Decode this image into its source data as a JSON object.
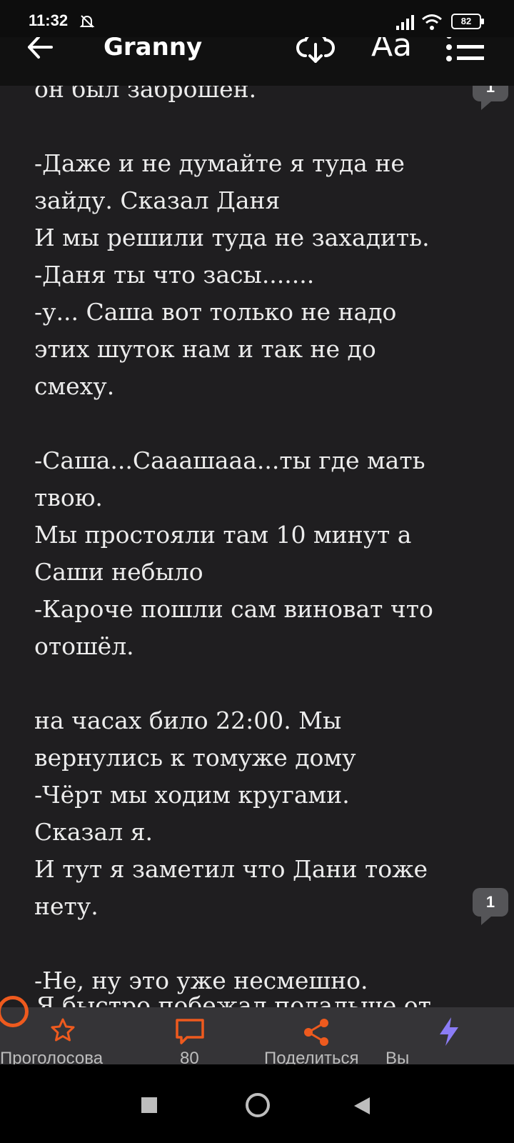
{
  "status_bar": {
    "time": "11:32",
    "battery": "82"
  },
  "toolbar": {
    "title": "Granny",
    "font_size_label": "Aa"
  },
  "story": {
    "lines": [
      "он был заброшен.",
      "",
      "-Даже и не думайте я туда не",
      "зайду. Сказал Даня",
      "И мы решили туда не захадить.",
      "-Даня ты что засы.......",
      "-у... Саша вот только не надо",
      "этих шуток нам и так не до",
      "смеху.",
      "",
      "-Саша...Сааашааа...ты где мать",
      "твою.",
      "Мы простояли там 10 минут а",
      "Саши небыло",
      "-Кароче пошли сам виноват что",
      "отошёл.",
      "",
      "на часах било 22:00. Мы",
      "вернулись к томуже дому",
      "-Чёрт мы ходим кругами.",
      "Сказал я.",
      "И тут я заметил что Дани тоже",
      "нету.",
      "",
      "-Не, ну это уже несмешно."
    ],
    "overflow_line": "Я быстро побежал подальше от",
    "comment_counts": [
      "1",
      "1"
    ]
  },
  "bottom_bar": {
    "vote_label": "Проголосова",
    "comments_label": "80",
    "share_label": "Поделиться",
    "boost_label": "Вы"
  },
  "colors": {
    "accent": "#ee5a1e",
    "boost": "#8b7cf6",
    "background": "#1f1e20",
    "toolbar": "#111111",
    "bottom_bar": "#353437"
  }
}
